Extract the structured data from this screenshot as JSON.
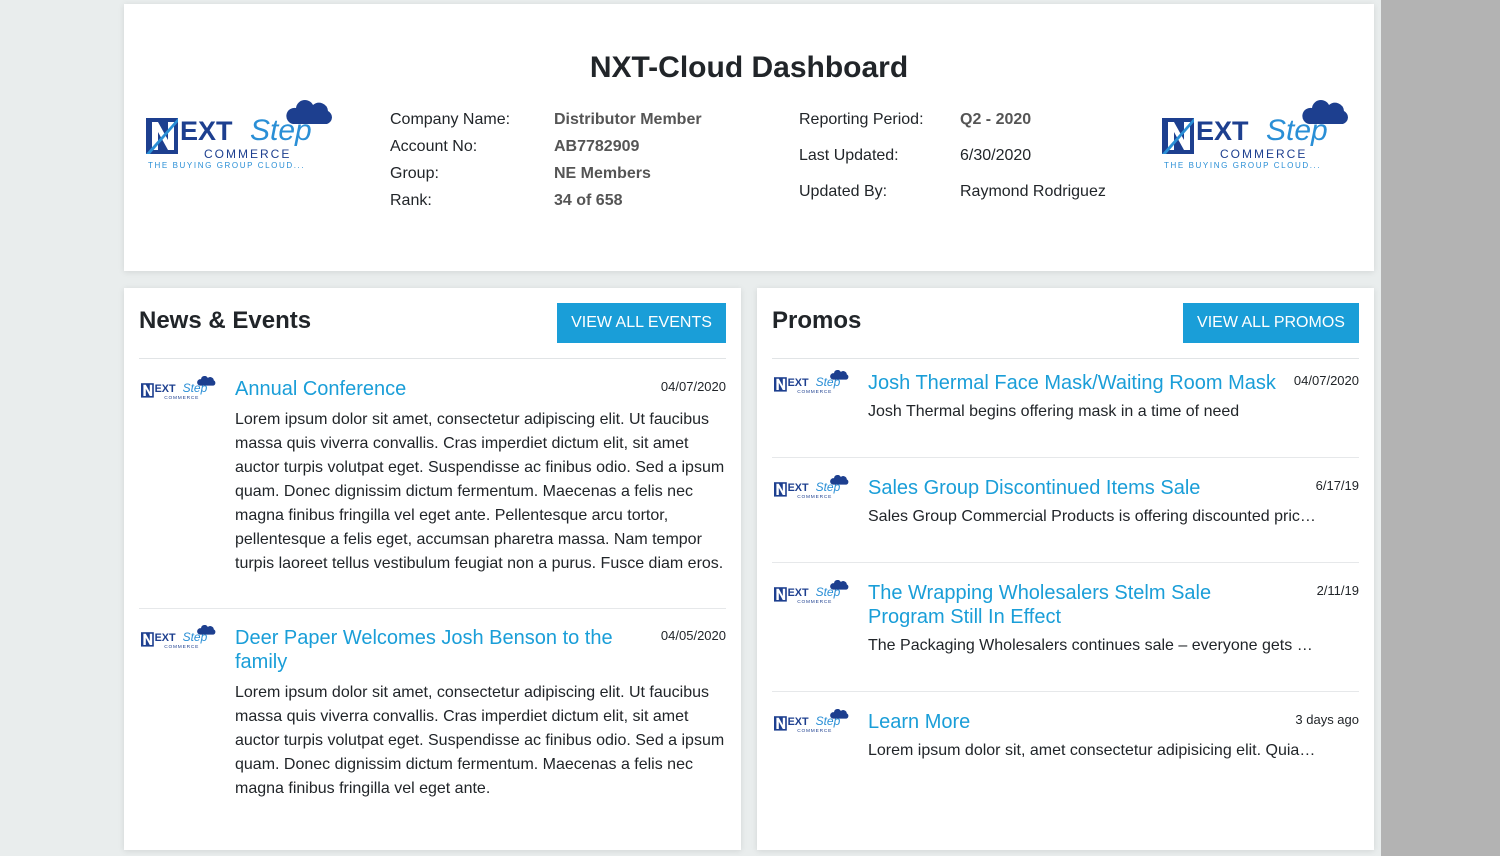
{
  "header": {
    "title": "NXT-Cloud Dashboard",
    "logo": {
      "main": "EXT",
      "step": "Step",
      "commerce": "COMMERCE",
      "tagline": "THE BUYING GROUP CLOUD..."
    },
    "company_label": "Company Name:",
    "company_value": "Distributor Member",
    "account_label": "Account No:",
    "account_value": "AB7782909",
    "group_label": "Group:",
    "group_value": "NE Members",
    "rank_label": "Rank:",
    "rank_value": "34 of 658",
    "period_label": "Reporting Period:",
    "period_value": "Q2 - 2020",
    "updated_label": "Last Updated:",
    "updated_value": "6/30/2020",
    "updated_by_label": "Updated By:",
    "updated_by_value": "Raymond Rodriguez"
  },
  "news": {
    "title": "News & Events",
    "button_label": "VIEW ALL EVENTS",
    "items": [
      {
        "title": "Annual Conference",
        "date": "04/07/2020",
        "body": "Lorem ipsum dolor sit amet, consectetur adipiscing elit. Ut faucibus massa quis viverra convallis. Cras imperdiet dictum elit, sit amet auctor turpis volutpat eget. Suspendisse ac finibus odio. Sed a ipsum quam. Donec dignissim dictum fermentum. Maecenas a felis nec magna finibus fringilla vel eget ante. Pellentesque arcu tortor, pellentesque a felis eget, accumsan pharetra massa. Nam tempor turpis laoreet tellus vestibulum feugiat non a purus. Fusce diam eros."
      },
      {
        "title": "Deer Paper Welcomes Josh Benson to the family",
        "date": "04/05/2020",
        "body": "Lorem ipsum dolor sit amet, consectetur adipiscing elit. Ut faucibus massa quis viverra convallis. Cras imperdiet dictum elit, sit amet auctor turpis volutpat eget. Suspendisse ac finibus odio. Sed a ipsum quam. Donec dignissim dictum fermentum. Maecenas a felis nec magna finibus fringilla vel eget ante."
      }
    ]
  },
  "promos": {
    "title": "Promos",
    "button_label": "VIEW ALL PROMOS",
    "items": [
      {
        "title": "Josh Thermal Face Mask/Waiting Room Mask",
        "date": "04/07/2020",
        "body": "Josh Thermal begins offering mask in a time of need"
      },
      {
        "title": "Sales Group Discontinued Items Sale",
        "date": "6/17/19",
        "body": "Sales Group Commercial Products is offering discounted prices on discontinued items"
      },
      {
        "title": "The Wrapping Wholesalers Stelm Sale Program Still In Effect",
        "date": "2/11/19",
        "body": "The Packaging Wholesalers continues sale – everyone gets a discount"
      },
      {
        "title": "Learn More",
        "date": "3 days ago",
        "body": "Lorem ipsum dolor sit, amet consectetur adipisicing elit. Quia voluptatem"
      }
    ]
  },
  "colors": {
    "accent": "#1a9ed8",
    "logo_navy": "#1d3f8f",
    "logo_blue": "#2a8fd6",
    "background": "#e9eded"
  }
}
